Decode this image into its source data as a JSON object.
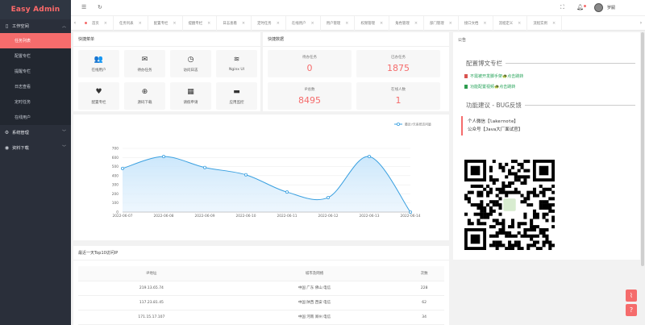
{
  "sidebar": {
    "brand": "Easy Admin",
    "groups": [
      {
        "label": "工作空间",
        "icon": "phone-icon",
        "items": [
          "任务列表",
          "配置专栏",
          "提醒专栏",
          "日志查看",
          "定时任务",
          "在线用户"
        ]
      },
      {
        "label": "系统管理",
        "icon": "gear-icon"
      },
      {
        "label": "资料下载",
        "icon": "eye-icon"
      }
    ]
  },
  "tabs": [
    {
      "label": "首页",
      "active": true
    },
    {
      "label": "任务列表"
    },
    {
      "label": "配置专栏"
    },
    {
      "label": "提醒专栏"
    },
    {
      "label": "日志查看"
    },
    {
      "label": "定时任务"
    },
    {
      "label": "在线用户"
    },
    {
      "label": "用户管理"
    },
    {
      "label": "权限管理"
    },
    {
      "label": "角色管理"
    },
    {
      "label": "部门管理"
    },
    {
      "label": "接口文档"
    },
    {
      "label": "流程定义"
    },
    {
      "label": "流程实例"
    }
  ],
  "quick_menu": {
    "title": "快捷菜单",
    "items": [
      {
        "label": "在线用户",
        "icon": "users-icon",
        "glyph": "👥"
      },
      {
        "label": "待办任务",
        "icon": "mail-icon",
        "glyph": "✉"
      },
      {
        "label": "访问日志",
        "icon": "clock-icon",
        "glyph": "◷"
      },
      {
        "label": "Nginx UI",
        "icon": "stack-icon",
        "glyph": "≋"
      },
      {
        "label": "配置专栏",
        "icon": "heart-icon",
        "glyph": "♥"
      },
      {
        "label": "源码下载",
        "icon": "globe-icon",
        "glyph": "⊕"
      },
      {
        "label": "请假申请",
        "icon": "table-icon",
        "glyph": "▦"
      },
      {
        "label": "应用监控",
        "icon": "chat-icon",
        "glyph": "▬"
      }
    ]
  },
  "quick_data": {
    "title": "快捷数据",
    "items": [
      {
        "label": "待办任务",
        "value": "0"
      },
      {
        "label": "已办任务",
        "value": "1875"
      },
      {
        "label": "IP总数",
        "value": "8495"
      },
      {
        "label": "在线人数",
        "value": "1"
      }
    ]
  },
  "notice": {
    "title": "公告",
    "column_title": "配置博文专栏",
    "links": [
      {
        "text": "不需被开发脚手架🐢点击跳转",
        "color": "#d9534f"
      },
      {
        "text": "功能配置视频🐢点击跳转",
        "color": "#2e9c4f"
      }
    ],
    "feedback_title": "功能建议 - BUG反馈",
    "feedback_lines": [
      "个人微信【lakernote】",
      "公众号【Java大厂面试官】"
    ],
    "colors": {
      "link_text": "#27a35a"
    }
  },
  "chart_data": {
    "type": "area",
    "legend": "最近7天系统访问量",
    "legend_position": "top-right",
    "categories": [
      "2022-06-07",
      "2022-06-08",
      "2022-06-09",
      "2022-06-10",
      "2022-06-11",
      "2022-06-12",
      "2022-06-13",
      "2022-06-14"
    ],
    "values": [
      480,
      610,
      490,
      410,
      220,
      160,
      610,
      0
    ],
    "y_ticks": [
      "0",
      "100",
      "200",
      "300",
      "400",
      "500",
      "600",
      "700"
    ],
    "ylim": [
      0,
      700
    ],
    "grid": true,
    "colors": {
      "line": "#3aa0e0",
      "fill": "#c9e6fb"
    }
  },
  "ip_table": {
    "title": "最近一天Top10访问IP",
    "columns": [
      "IP地址",
      "城市及网络",
      "次数"
    ],
    "rows": [
      [
        "219.13.65.74",
        "中国 广东 佛山 电信",
        "228"
      ],
      [
        "117.23.81.45",
        "中国 陕西 西安 电信",
        "62"
      ],
      [
        "171.15.17.107",
        "中国 河南 郑州 电信",
        "34"
      ]
    ]
  },
  "colors": {
    "accent": "#f56c6c",
    "sidebar": "#2a2f3a"
  }
}
